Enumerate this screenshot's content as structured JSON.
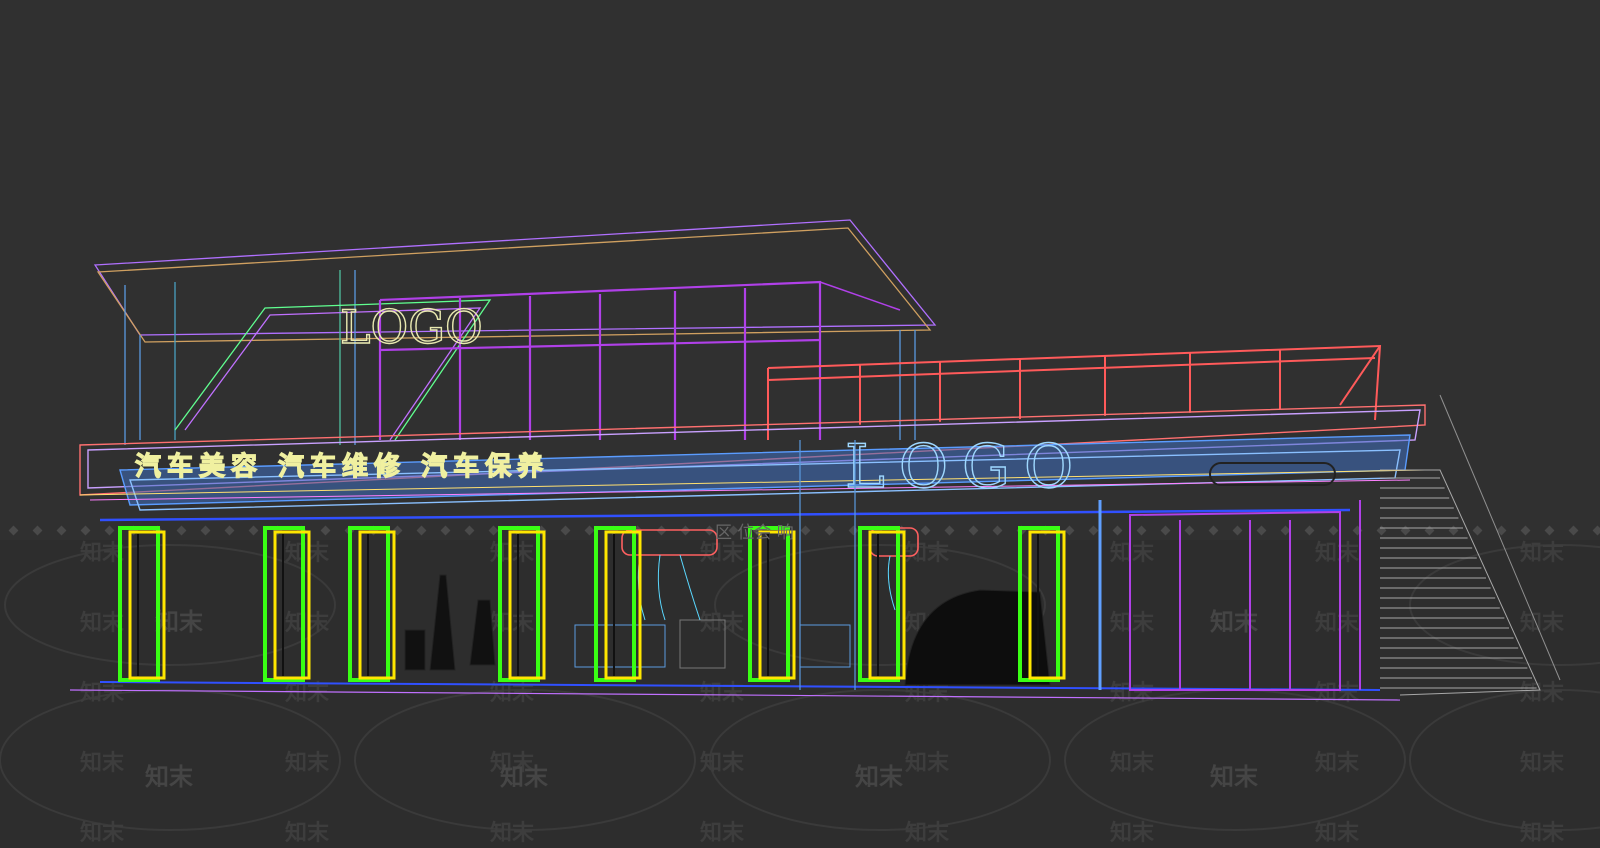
{
  "scene": {
    "background_color": "#303030",
    "floor_color": "#2e2e2e",
    "signboard_text": "汽车美容 汽车维修 汽车保养",
    "upper_logo": "LOGO",
    "front_logo": "LOGO",
    "small_label": "区  位会  响",
    "watermark": "知末"
  },
  "colors": {
    "door_green": "#39ff14",
    "door_yellow": "#ffe600",
    "frame_purple": "#a040e0",
    "railing_red": "#ff5050",
    "canopy_blue": "#4a8cff",
    "stairs_gray": "#a8a8a8"
  }
}
